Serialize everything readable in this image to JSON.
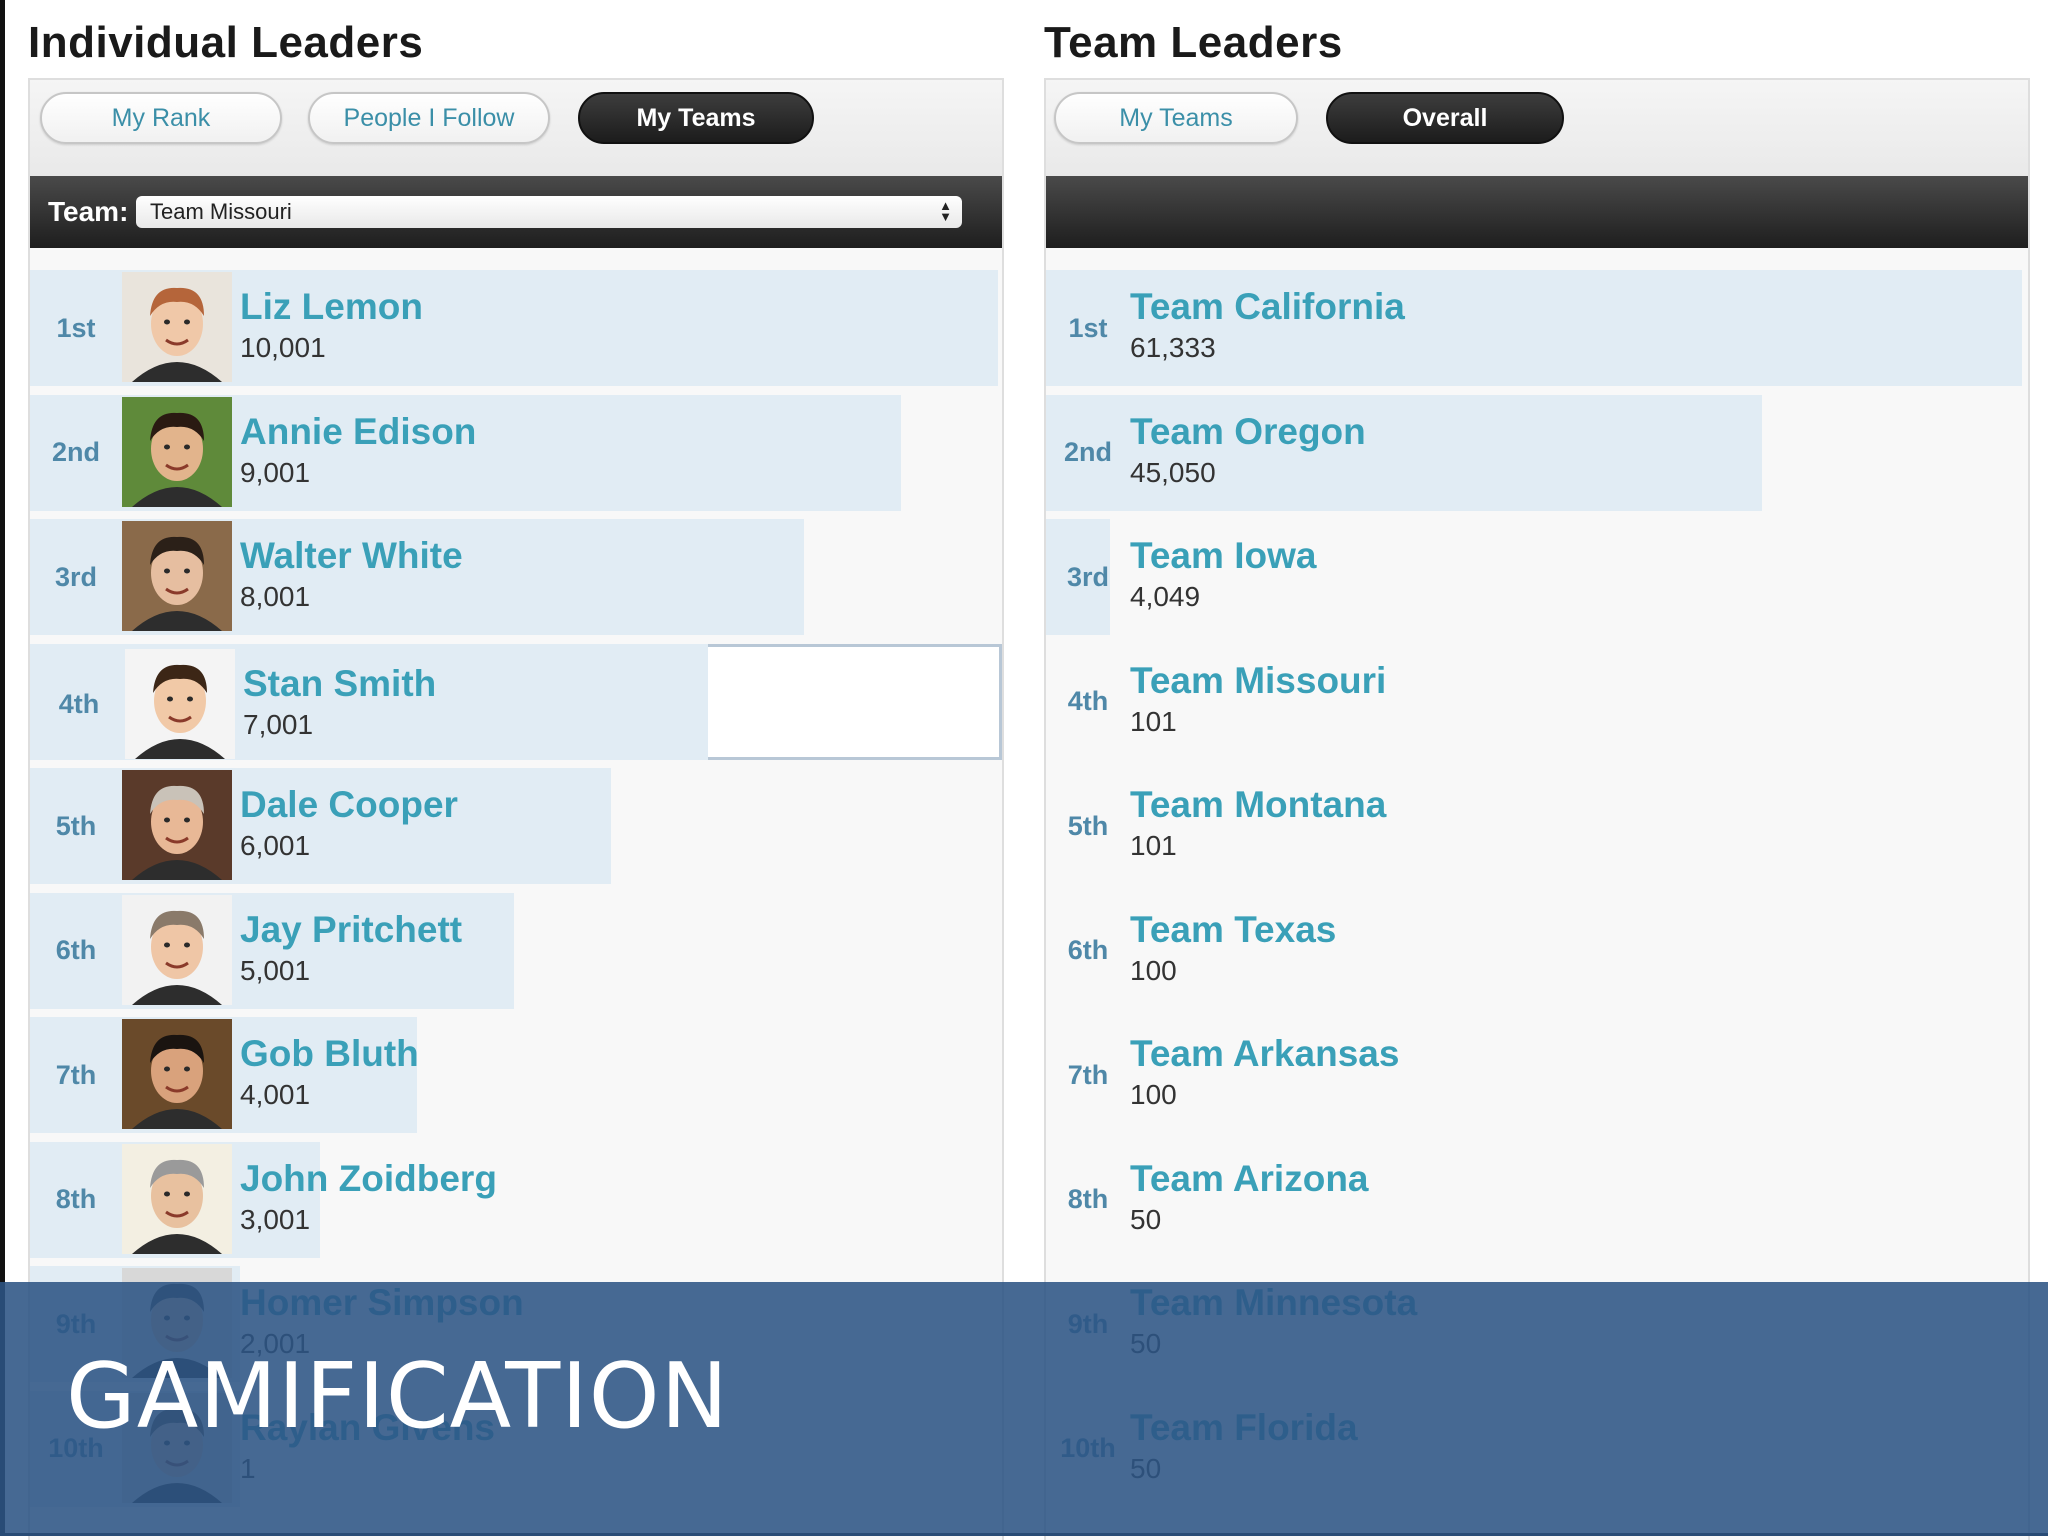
{
  "individual": {
    "title": "Individual Leaders",
    "tabs": [
      {
        "label": "My Rank",
        "active": false
      },
      {
        "label": "People I Follow",
        "active": false
      },
      {
        "label": "My Teams",
        "active": true
      }
    ],
    "team_filter": {
      "label": "Team:",
      "selected": "Team Missouri"
    },
    "leaders": [
      {
        "rank": "1st",
        "name": "Liz Lemon",
        "score": "10,001",
        "bar_fraction": 1.0
      },
      {
        "rank": "2nd",
        "name": "Annie Edison",
        "score": "9,001",
        "bar_fraction": 0.9
      },
      {
        "rank": "3rd",
        "name": "Walter White",
        "score": "8,001",
        "bar_fraction": 0.8
      },
      {
        "rank": "4th",
        "name": "Stan Smith",
        "score": "7,001",
        "bar_fraction": 0.7,
        "highlighted": true
      },
      {
        "rank": "5th",
        "name": "Dale Cooper",
        "score": "6,001",
        "bar_fraction": 0.6
      },
      {
        "rank": "6th",
        "name": "Jay Pritchett",
        "score": "5,001",
        "bar_fraction": 0.5
      },
      {
        "rank": "7th",
        "name": "Gob Bluth",
        "score": "4,001",
        "bar_fraction": 0.4
      },
      {
        "rank": "8th",
        "name": "John Zoidberg",
        "score": "3,001",
        "bar_fraction": 0.3
      },
      {
        "rank": "9th",
        "name": "Homer Simpson",
        "score": "2,001",
        "bar_fraction": 0.2
      },
      {
        "rank": "10th",
        "name": "Raylan Givens",
        "score": "1",
        "bar_fraction": 0.0
      }
    ]
  },
  "teams": {
    "title": "Team Leaders",
    "tabs": [
      {
        "label": "My Teams",
        "active": false
      },
      {
        "label": "Overall",
        "active": true
      }
    ],
    "leaders": [
      {
        "rank": "1st",
        "name": "Team California",
        "score": "61,333",
        "bar_fraction": 1.0
      },
      {
        "rank": "2nd",
        "name": "Team Oregon",
        "score": "45,050",
        "bar_fraction": 0.734
      },
      {
        "rank": "3rd",
        "name": "Team Iowa",
        "score": "4,049",
        "bar_fraction": 0.066
      },
      {
        "rank": "4th",
        "name": "Team Missouri",
        "score": "101",
        "bar_fraction": 0.0
      },
      {
        "rank": "5th",
        "name": "Team Montana",
        "score": "101",
        "bar_fraction": 0.0
      },
      {
        "rank": "6th",
        "name": "Team Texas",
        "score": "100",
        "bar_fraction": 0.0
      },
      {
        "rank": "7th",
        "name": "Team Arkansas",
        "score": "100",
        "bar_fraction": 0.0
      },
      {
        "rank": "8th",
        "name": "Team Arizona",
        "score": "50",
        "bar_fraction": 0.0
      },
      {
        "rank": "9th",
        "name": "Team Minnesota",
        "score": "50",
        "bar_fraction": 0.0
      },
      {
        "rank": "10th",
        "name": "Team Florida",
        "score": "50",
        "bar_fraction": 0.0
      }
    ]
  },
  "overlay": {
    "title": "GAMIFICATION"
  },
  "colors": {
    "name_link": "#3aa0b8",
    "rank_text": "#4f88a8",
    "bar": "#e1ecf4",
    "overlay": "#2c5484"
  }
}
